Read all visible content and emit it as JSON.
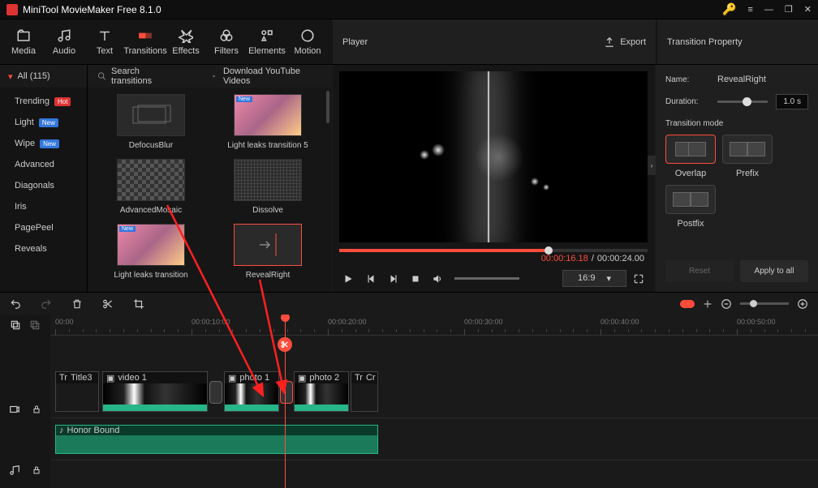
{
  "app": {
    "title": "MiniTool MovieMaker Free 8.1.0"
  },
  "tabs": [
    {
      "label": "Media"
    },
    {
      "label": "Audio"
    },
    {
      "label": "Text"
    },
    {
      "label": "Transitions"
    },
    {
      "label": "Effects"
    },
    {
      "label": "Filters"
    },
    {
      "label": "Elements"
    },
    {
      "label": "Motion"
    }
  ],
  "playerHeader": "Player",
  "exportLabel": "Export",
  "propHeader": "Transition Property",
  "categories": {
    "all": "All (115)",
    "items": [
      {
        "label": "Trending",
        "badge": "Hot",
        "badgeClass": "bhot",
        "active": true
      },
      {
        "label": "Light",
        "badge": "New",
        "badgeClass": "bnew"
      },
      {
        "label": "Wipe",
        "badge": "New",
        "badgeClass": "bnew"
      },
      {
        "label": "Advanced"
      },
      {
        "label": "Diagonals"
      },
      {
        "label": "Iris"
      },
      {
        "label": "PagePeel"
      },
      {
        "label": "Reveals"
      }
    ]
  },
  "gridHeader": {
    "search": "Search transitions",
    "download": "Download YouTube Videos"
  },
  "thumbs": [
    {
      "label": "DefocusBlur"
    },
    {
      "label": "Light leaks transition 5"
    },
    {
      "label": "AdvancedMosaic"
    },
    {
      "label": "Dissolve"
    },
    {
      "label": "Light leaks transition"
    },
    {
      "label": "RevealRight"
    }
  ],
  "time": {
    "current": "00:00:16.18",
    "total": "00:00:24.00"
  },
  "ratio": "16:9",
  "property": {
    "nameLabel": "Name:",
    "name": "RevealRight",
    "durLabel": "Duration:",
    "dur": "1.0 s",
    "modeLabel": "Transition mode",
    "modes": [
      "Overlap",
      "Prefix",
      "Postfix"
    ],
    "reset": "Reset",
    "apply": "Apply to all"
  },
  "ruler": [
    "00:00",
    "00:00:10:00",
    "00:00:20:00",
    "00:00:30:00",
    "00:00:40:00",
    "00:00:50:00"
  ],
  "clips": {
    "title": "Title3",
    "video": "video 1",
    "photo1": "photo 1",
    "photo2": "photo 2",
    "cr": "Cr",
    "audio": "Honor Bound"
  }
}
